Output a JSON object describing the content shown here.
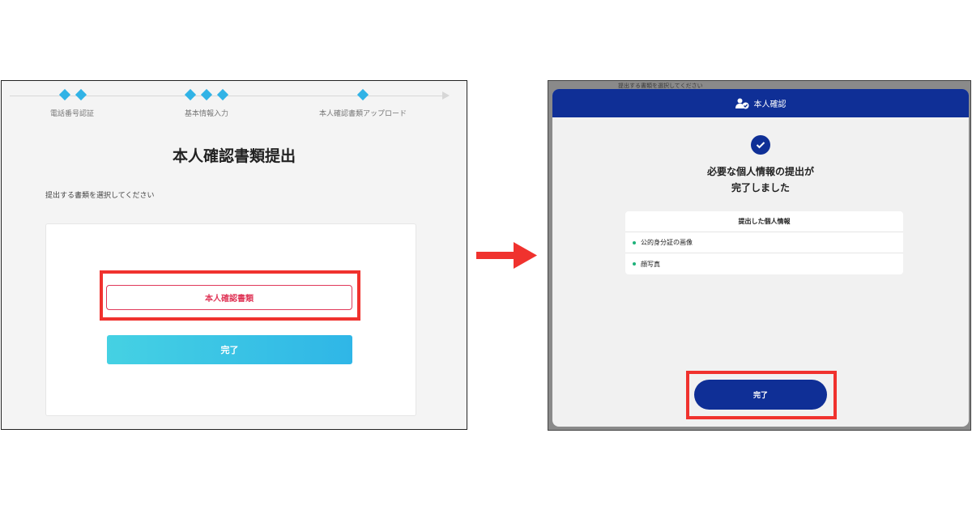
{
  "left_screen": {
    "steps": [
      {
        "label": "電話番号認証",
        "diamond_count": 2
      },
      {
        "label": "基本情報入力",
        "diamond_count": 3
      },
      {
        "label": "本人確認書類アップロード",
        "diamond_count": 1
      }
    ],
    "page_title": "本人確認書類提出",
    "instruction": "提出する書類を選択してください",
    "document_button_label": "本人確認書類",
    "done_button_label": "完了"
  },
  "right_screen": {
    "background_text": "提出する書類を選択してください",
    "modal": {
      "header_title": "本人確認",
      "header_icon": "user-check-icon",
      "success_line1": "必要な個人情報の提出が",
      "success_line2": "完了しました",
      "submitted_title": "提出した個人情報",
      "submitted_items": [
        "公的身分証の画像",
        "顔写真"
      ],
      "done_button_label": "完了"
    }
  },
  "colors": {
    "step_diamond": "#31b3e6",
    "document_button_border": "#e0395a",
    "done_button_left": "#2fb6e7",
    "modal_header": "#0f2f96",
    "done_button_right": "#0f2f96",
    "highlight": "#f0322e",
    "arrow": "#f0322e",
    "bullet": "#1eb27a"
  },
  "transition_arrow_icon": "right-arrow-icon"
}
